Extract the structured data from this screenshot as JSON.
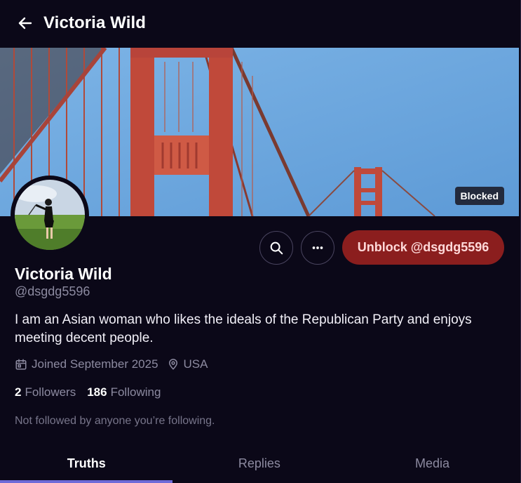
{
  "header": {
    "title": "Victoria Wild"
  },
  "banner": {
    "blocked_label": "Blocked"
  },
  "actions": {
    "unblock_label": "Unblock @dsgdg5596"
  },
  "profile": {
    "display_name": "Victoria Wild",
    "handle": "@dsgdg5596",
    "bio": "I am an Asian woman who likes the ideals of the Republican Party and enjoys meeting decent people.",
    "joined": "Joined September 2025",
    "location": "USA",
    "followers_count": "2",
    "followers_label": "Followers",
    "following_count": "186",
    "following_label": "Following",
    "not_followed_note": "Not followed by anyone you’re following."
  },
  "tabs": [
    {
      "label": "Truths",
      "active": true
    },
    {
      "label": "Replies",
      "active": false
    },
    {
      "label": "Media",
      "active": false
    }
  ],
  "icons": {
    "back": "arrow-left-icon",
    "search": "search-icon",
    "more": "more-horizontal-icon",
    "calendar": "calendar-icon",
    "location": "map-pin-icon"
  },
  "colors": {
    "background": "#0b0818",
    "unblock_button": "#8b1e1e",
    "active_tab_indicator": "#6e6ad8",
    "muted_text": "#8c8aa0"
  }
}
